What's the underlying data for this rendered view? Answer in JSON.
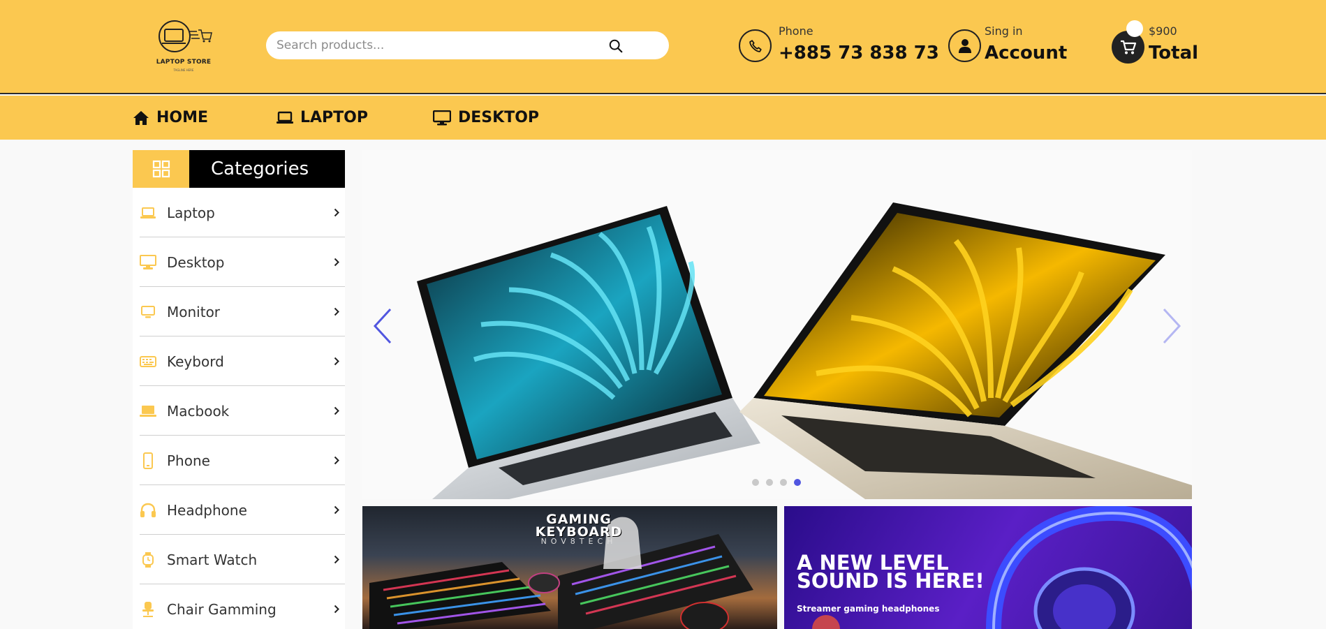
{
  "logo": {
    "name": "LAPTOP STORE",
    "tagline": "TAGLINE HERE"
  },
  "search": {
    "placeholder": "Search products..."
  },
  "phone": {
    "label": "Phone",
    "number": "+885 73 838 73"
  },
  "account": {
    "label": "Sing in",
    "title": "Account"
  },
  "cart": {
    "amount": "$900",
    "title": "Total",
    "count": ""
  },
  "nav": {
    "home": "HOME",
    "laptop": "LAPTOP",
    "desktop": "DESKTOP"
  },
  "categories": {
    "title": "Categories",
    "items": [
      {
        "label": "Laptop",
        "icon": "laptop-icon"
      },
      {
        "label": "Desktop",
        "icon": "desktop-icon"
      },
      {
        "label": "Monitor",
        "icon": "monitor-icon"
      },
      {
        "label": "Keybord",
        "icon": "keyboard-icon"
      },
      {
        "label": "Macbook",
        "icon": "macbook-icon"
      },
      {
        "label": "Phone",
        "icon": "phone-icon"
      },
      {
        "label": "Headphone",
        "icon": "headphone-icon"
      },
      {
        "label": "Smart Watch",
        "icon": "watch-icon"
      },
      {
        "label": "Chair Gamming",
        "icon": "chair-icon"
      }
    ]
  },
  "slider": {
    "slide_count": 4,
    "active_index": 3
  },
  "banners": {
    "keyboard": {
      "title_line1": "GAMING",
      "title_line2": "KEYBOARD",
      "brand": "NOV8TECH"
    },
    "headphone": {
      "title_line1": "A NEW LEVEL",
      "title_line2": "SOUND IS HERE!",
      "subtitle": "Streamer gaming headphones"
    }
  },
  "colors": {
    "accent": "#fbc850",
    "dark": "#111111",
    "slider_dot_active": "#5156e0",
    "arrow": "#5156e0"
  }
}
